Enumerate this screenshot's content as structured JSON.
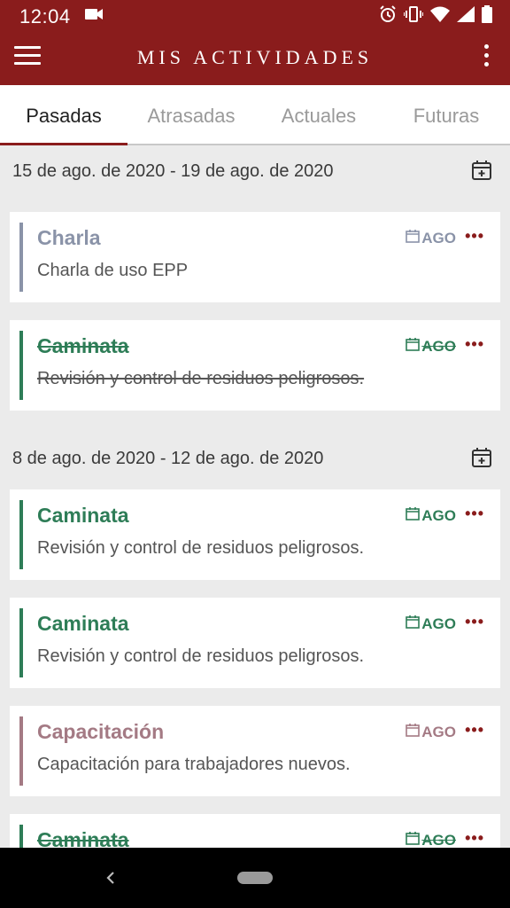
{
  "status_bar": {
    "time": "12:04",
    "icons": [
      "camera-icon",
      "alarm-icon",
      "vibrate-icon",
      "wifi-icon",
      "signal-icon",
      "battery-icon"
    ]
  },
  "app_bar": {
    "title": "MIS ACTIVIDADES",
    "menu_icon": "hamburger-menu-icon",
    "more_icon": "more-vertical-icon"
  },
  "tabs": [
    {
      "label": "Pasadas",
      "active": true
    },
    {
      "label": "Atrasadas",
      "active": false
    },
    {
      "label": "Actuales",
      "active": false
    },
    {
      "label": "Futuras",
      "active": false
    }
  ],
  "sections": [
    {
      "date_range": "15 de ago. de 2020 - 19 de ago. de 2020",
      "items": [
        {
          "title": "Charla",
          "description": "Charla de uso EPP",
          "tag": "AGO",
          "color": "#8a93a8",
          "done": false
        },
        {
          "title": "Caminata",
          "description": "Revisión y control de residuos peligrosos.",
          "tag": "AGO",
          "color": "#2e7d57",
          "done": true
        }
      ]
    },
    {
      "date_range": "8 de ago. de 2020 - 12 de ago. de 2020",
      "items": [
        {
          "title": "Caminata",
          "description": "Revisión y control de residuos peligrosos.",
          "tag": "AGO",
          "color": "#2e7d57",
          "done": false
        },
        {
          "title": "Caminata",
          "description": "Revisión y control de residuos peligrosos.",
          "tag": "AGO",
          "color": "#2e7d57",
          "done": false
        },
        {
          "title": "Capacitación",
          "description": "Capacitación para trabajadores nuevos.",
          "tag": "AGO",
          "color": "#a47a84",
          "done": false
        },
        {
          "title": "Caminata",
          "description": "",
          "tag": "AGO",
          "color": "#2e7d57",
          "done": true
        }
      ]
    }
  ],
  "item_menu": "•••",
  "colors": {
    "brand": "#8a1c1c",
    "background": "#ebebeb"
  }
}
